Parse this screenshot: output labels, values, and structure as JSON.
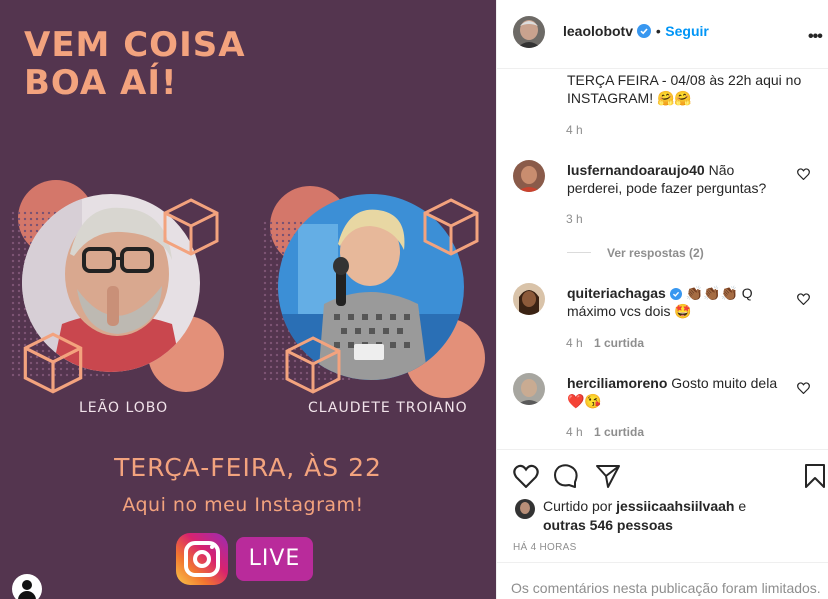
{
  "post": {
    "headline_line1": "VEM COISA",
    "headline_line2": "BOA AÍ!",
    "person1": "LEÃO LOBO",
    "person2": "CLAUDETE TROIANO",
    "day": "TERÇA-FEIRA, ÀS 22",
    "subtitle": "Aqui no meu Instagram!",
    "live_label": "LIVE",
    "colors": {
      "background": "#54354f",
      "accent": "#f3a37e",
      "live": "#b92b9b"
    }
  },
  "header": {
    "username": "leaolobotv",
    "follow_label": "Seguir",
    "more_icon": "more-horizontal-icon"
  },
  "caption": {
    "text_line1": "TERÇA FEIRA - 04/08 às 22h aqui no",
    "text_line2": "INSTAGRAM! 🤗🤗",
    "time": "4 h"
  },
  "comments": [
    {
      "username": "lusfernandoaraujo40",
      "text_line1": "Não",
      "text_line2": "perderei, pode fazer perguntas?",
      "time": "3 h",
      "likes": "",
      "replies": "Ver respostas (2)"
    },
    {
      "username": "quiteriachagas",
      "text_line1": "👏🏾👏🏾👏🏾 Q",
      "text_line2": "máximo vcs dois 🤩",
      "time": "4 h",
      "likes": "1 curtida"
    },
    {
      "username": "herciliamoreno",
      "text_line1": "Gosto muito dela",
      "text_line2": "❤️😘",
      "time": "4 h",
      "likes": "1 curtida"
    }
  ],
  "footer": {
    "liked_prefix": "Curtido por",
    "liked_user": "jessiicaahsiilvaah",
    "liked_and": "e",
    "liked_others": "outras 546 pessoas",
    "time_ago": "HÁ 4 HORAS",
    "limited_notice": "Os comentários nesta publicação foram limitados."
  }
}
